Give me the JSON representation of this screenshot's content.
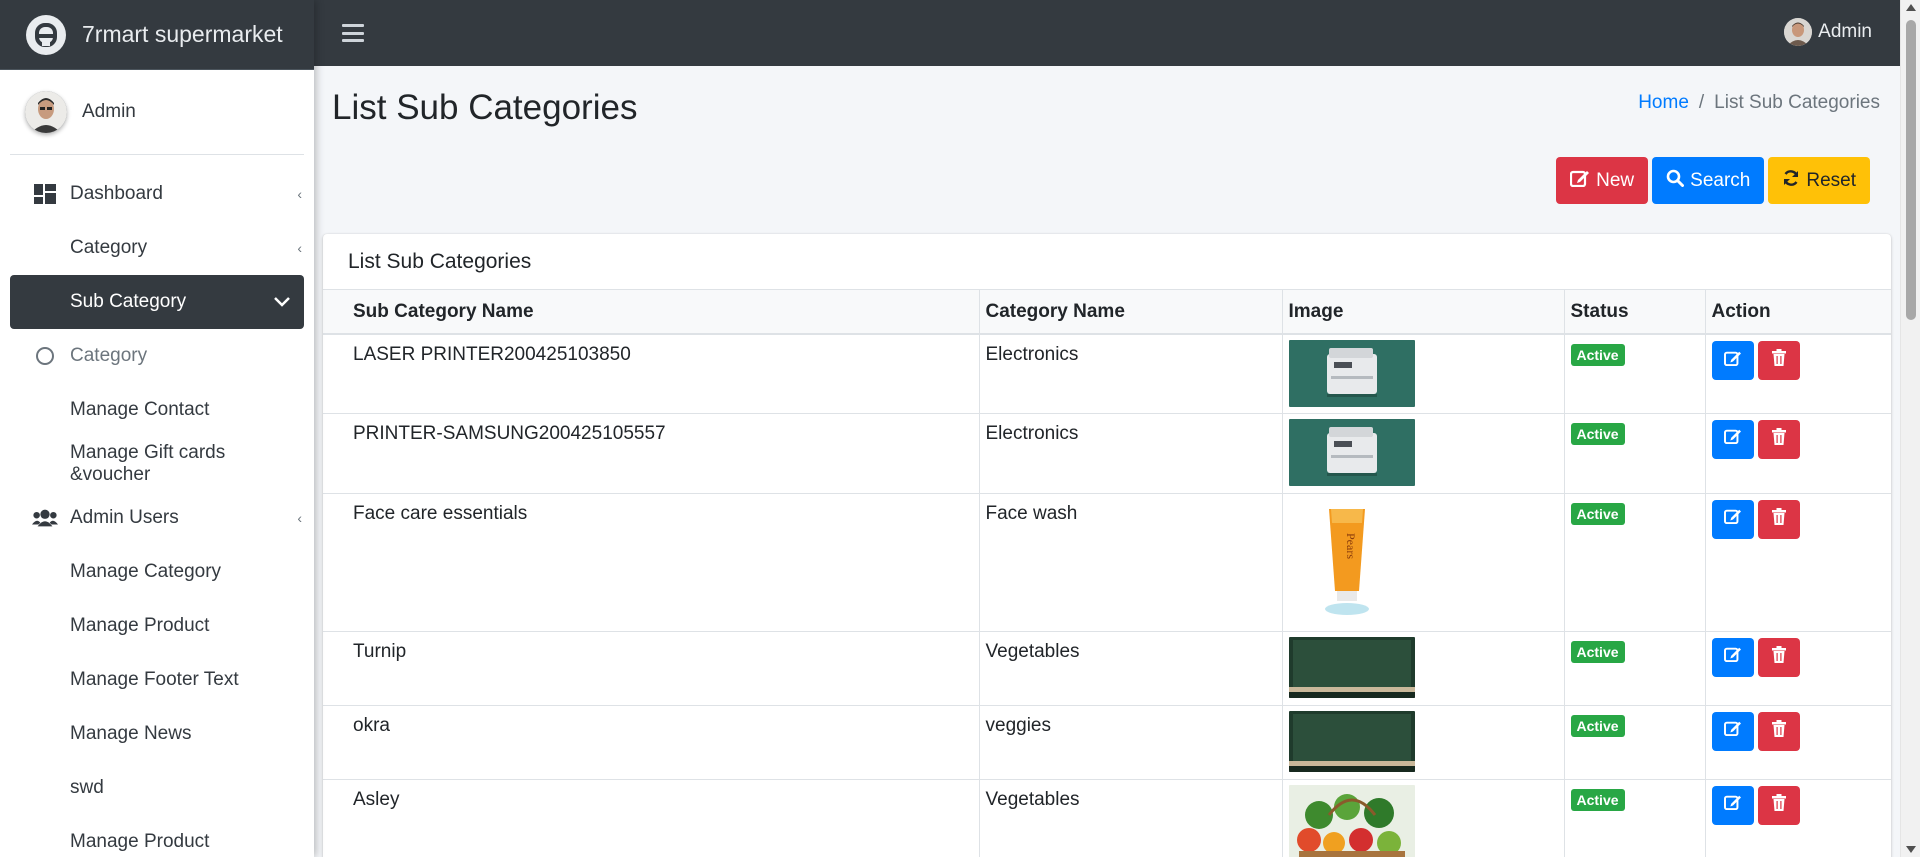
{
  "brand": {
    "title": "7rmart supermarket"
  },
  "user": {
    "name": "Admin"
  },
  "topbar": {
    "user_name": "Admin"
  },
  "sidebar": {
    "items": [
      {
        "label": "Dashboard",
        "icon": "dashboard-icon",
        "caret": "‹"
      },
      {
        "label": "Category",
        "icon": "",
        "caret": "‹"
      },
      {
        "label": "Sub Category",
        "icon": "",
        "caret": "⌄"
      },
      {
        "label": "Category",
        "icon": "circle-icon",
        "caret": ""
      },
      {
        "label": "Manage Contact",
        "icon": "",
        "caret": ""
      },
      {
        "label": "Manage Gift cards &voucher",
        "icon": "",
        "caret": ""
      },
      {
        "label": "Admin Users",
        "icon": "users-icon",
        "caret": "‹"
      },
      {
        "label": "Manage Category",
        "icon": "",
        "caret": ""
      },
      {
        "label": "Manage Product",
        "icon": "",
        "caret": ""
      },
      {
        "label": "Manage Footer Text",
        "icon": "",
        "caret": ""
      },
      {
        "label": "Manage News",
        "icon": "",
        "caret": ""
      },
      {
        "label": "swd",
        "icon": "",
        "caret": ""
      },
      {
        "label": "Manage Product",
        "icon": "",
        "caret": ""
      }
    ]
  },
  "page": {
    "title": "List Sub Categories",
    "breadcrumb": {
      "home": "Home",
      "separator": "/",
      "current": "List Sub Categories"
    }
  },
  "actions": {
    "new_label": "New",
    "search_label": "Search",
    "reset_label": "Reset"
  },
  "table": {
    "card_title": "List Sub Categories",
    "columns": [
      "Sub Category Name",
      "Category Name",
      "Image",
      "Status",
      "Action"
    ],
    "rows": [
      {
        "name": "LASER PRINTER200425103850",
        "category": "Electronics",
        "image": "printer",
        "status": "Active"
      },
      {
        "name": "PRINTER-SAMSUNG200425105557",
        "category": "Electronics",
        "image": "printer",
        "status": "Active"
      },
      {
        "name": "Face care essentials",
        "category": "Face wash",
        "image": "facewash",
        "status": "Active"
      },
      {
        "name": "Turnip",
        "category": "Vegetables",
        "image": "green-board",
        "status": "Active"
      },
      {
        "name": "okra",
        "category": "veggies",
        "image": "green-board",
        "status": "Active"
      },
      {
        "name": "Asley",
        "category": "Vegetables",
        "image": "veg-basket",
        "status": "Active"
      }
    ]
  },
  "colors": {
    "sidebar_dark": "#343a40",
    "primary": "#007bff",
    "danger": "#dc3545",
    "warning": "#ffc107",
    "success": "#28a745"
  }
}
